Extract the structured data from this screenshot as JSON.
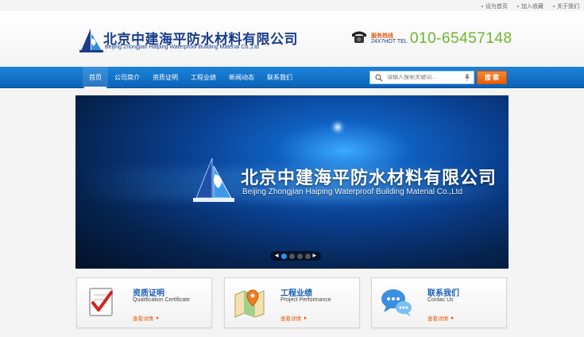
{
  "top_links": [
    "设为首页",
    "加入收藏",
    "关于我们"
  ],
  "header": {
    "company_cn": "北京中建海平防水材料有限公司",
    "company_en": "Beijing Zhongjian Haiping Waterproof Building Material Co.,Ltd",
    "hotline_label_cn": "服务热线",
    "hotline_label_en": "24X7HOT TEL",
    "phone": "010-65457148"
  },
  "nav": {
    "items": [
      "首页",
      "公司简介",
      "资质证明",
      "工程业绩",
      "新闻动态",
      "联系我们"
    ],
    "active_index": 0
  },
  "search": {
    "placeholder": "请输入搜索关键词...",
    "button_label": "搜 索"
  },
  "banner": {
    "title_cn": "北京中建海平防水材料有限公司",
    "title_en": "Beijing Zhongjian Haiping Waterproof Building Material Co.,Ltd",
    "slide_count": 4,
    "active_slide": 0
  },
  "features": [
    {
      "title": "资质证明",
      "subtitle": "Qualification Certificate",
      "more": "查看详情",
      "icon": "certificate-icon"
    },
    {
      "title": "工程业绩",
      "subtitle": "Project Performance",
      "more": "查看详情",
      "icon": "map-pin-icon"
    },
    {
      "title": "联系我们",
      "subtitle": "Contac Us",
      "more": "查看详情",
      "icon": "chat-bubbles-icon"
    }
  ],
  "colors": {
    "brand_blue": "#1a3e8c",
    "nav_blue": "#0c63b8",
    "accent_orange": "#e6600a",
    "phone_green": "#6cb52b"
  }
}
